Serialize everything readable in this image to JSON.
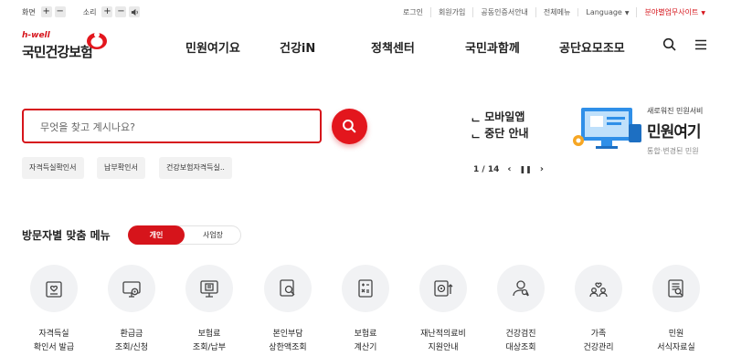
{
  "utility": {
    "screen_label": "화면",
    "sound_label": "소리",
    "plus": "+",
    "minus": "−",
    "links": [
      "로그인",
      "회원가입",
      "공동인증서안내",
      "전체메뉴"
    ],
    "language": "Language",
    "branch_site": "분야별업무사이트"
  },
  "logo": {
    "tagline": "h-well",
    "name": "국민건강보험"
  },
  "gnb": [
    "민원여기요",
    "건강iN",
    "정책센터",
    "국민과함께",
    "공단요모조모"
  ],
  "icons": {
    "search": "search-icon",
    "menu": "hamburger-menu-icon"
  },
  "search": {
    "placeholder": "무엇을 찾고 계시나요?"
  },
  "quick_chips": [
    "자격득실확인서",
    "납부확인서",
    "건강보험자격득실.."
  ],
  "banner": {
    "line1": "ᆫ 모바일앱",
    "line2": "ᆫ 중단 안내",
    "page": "1 / 14",
    "prev": "‹",
    "pause": "❚❚",
    "next": "›",
    "image_text1": "새로워진 민원서비",
    "image_text2": "민원여기",
    "image_text3": "통합·변경된 민원"
  },
  "personal_menu": {
    "title": "방문자별 맞춤 메뉴",
    "tab_personal": "개인",
    "tab_business": "사업장",
    "items": [
      {
        "line1": "자격득실",
        "line2": "확인서 발급",
        "icon": "certificate-heart-icon"
      },
      {
        "line1": "환급금",
        "line2": "조회/신청",
        "icon": "monitor-refund-icon"
      },
      {
        "line1": "보험료",
        "line2": "조회/납부",
        "icon": "bill-screen-icon"
      },
      {
        "line1": "본인부담",
        "line2": "상한액조회",
        "icon": "document-search-icon"
      },
      {
        "line1": "보험료",
        "line2": "계산기",
        "icon": "calculator-icon"
      },
      {
        "line1": "재난적의료비",
        "line2": "지원안내",
        "icon": "medical-support-icon"
      },
      {
        "line1": "건강검진",
        "line2": "대상조회",
        "icon": "checkup-person-icon"
      },
      {
        "line1": "가족",
        "line2": "건강관리",
        "icon": "family-heart-icon"
      },
      {
        "line1": "민원",
        "line2": "서식자료실",
        "icon": "form-library-icon"
      }
    ]
  },
  "colors": {
    "accent": "#d6141b",
    "chip_bg": "#f2f2f2",
    "icon_circle": "#f1f2f4"
  }
}
